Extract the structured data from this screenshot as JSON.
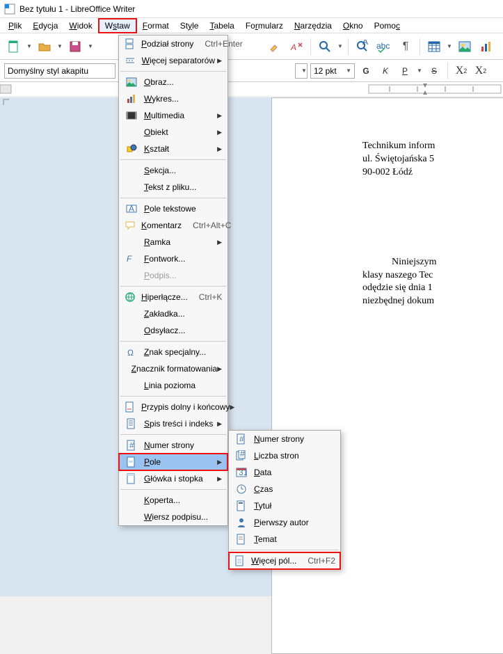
{
  "window": {
    "title": "Bez tytułu 1 - LibreOffice Writer"
  },
  "menubar": {
    "items": [
      "Plik",
      "Edycja",
      "Widok",
      "Wstaw",
      "Format",
      "Style",
      "Tabela",
      "Formularz",
      "Narzędzia",
      "Okno",
      "Pomoc"
    ],
    "open_index": 3
  },
  "fmtbar": {
    "style": "Domyślny styl akapitu",
    "fontsize": "12 pkt",
    "bold": "G",
    "italic": "K",
    "underline": "P",
    "strike": "S",
    "sup": "X²",
    "sub": "X₂"
  },
  "document": {
    "lines": [
      "Technikum inform",
      "ul. Świętojańska 5",
      "90-002 Łódź",
      "",
      "",
      "            Niniejszym",
      "klasy naszego Tec",
      "odędzie się dnia 1",
      "niezbędnej dokum"
    ]
  },
  "insert_menu": [
    {
      "type": "item",
      "icon": "page-break",
      "label": "Podział strony",
      "shortcut": "Ctrl+Enter"
    },
    {
      "type": "item",
      "icon": "separators",
      "label": "Więcej separatorów",
      "submenu": true
    },
    {
      "type": "sep"
    },
    {
      "type": "item",
      "icon": "image",
      "label": "Obraz..."
    },
    {
      "type": "item",
      "icon": "chart",
      "label": "Wykres..."
    },
    {
      "type": "item",
      "icon": "media",
      "label": "Multimedia",
      "submenu": true
    },
    {
      "type": "item",
      "icon": "object",
      "label": "Obiekt",
      "submenu": true
    },
    {
      "type": "item",
      "icon": "shape",
      "label": "Kształt",
      "submenu": true
    },
    {
      "type": "sep"
    },
    {
      "type": "item",
      "label": "Sekcja..."
    },
    {
      "type": "item",
      "label": "Tekst z pliku..."
    },
    {
      "type": "sep"
    },
    {
      "type": "item",
      "icon": "textbox",
      "label": "Pole tekstowe"
    },
    {
      "type": "item",
      "icon": "comment",
      "label": "Komentarz",
      "shortcut": "Ctrl+Alt+C"
    },
    {
      "type": "item",
      "label": "Ramka",
      "submenu": true
    },
    {
      "type": "item",
      "icon": "fontwork",
      "label": "Fontwork..."
    },
    {
      "type": "item",
      "label": "Podpis...",
      "disabled": true
    },
    {
      "type": "sep"
    },
    {
      "type": "item",
      "icon": "hyperlink",
      "label": "Hiperłącze...",
      "shortcut": "Ctrl+K"
    },
    {
      "type": "item",
      "label": "Zakładka..."
    },
    {
      "type": "item",
      "label": "Odsyłacz..."
    },
    {
      "type": "sep"
    },
    {
      "type": "item",
      "icon": "special",
      "label": "Znak specjalny..."
    },
    {
      "type": "item",
      "label": "Znacznik formatowania",
      "submenu": true
    },
    {
      "type": "item",
      "label": "Linia pozioma"
    },
    {
      "type": "sep"
    },
    {
      "type": "item",
      "icon": "footnote",
      "label": "Przypis dolny i końcowy",
      "submenu": true
    },
    {
      "type": "item",
      "icon": "toc",
      "label": "Spis treści i indeks",
      "submenu": true
    },
    {
      "type": "sep"
    },
    {
      "type": "item",
      "icon": "pagenum",
      "label": "Numer strony"
    },
    {
      "type": "item",
      "icon": "field",
      "label": "Pole",
      "submenu": true,
      "highlight": true,
      "boxed": true
    },
    {
      "type": "item",
      "icon": "header",
      "label": "Główka i stopka",
      "submenu": true
    },
    {
      "type": "sep"
    },
    {
      "type": "item",
      "label": "Koperta..."
    },
    {
      "type": "item",
      "label": "Wiersz podpisu..."
    }
  ],
  "field_submenu": [
    {
      "type": "item",
      "icon": "pagenum",
      "label": "Numer strony"
    },
    {
      "type": "item",
      "icon": "pagecount",
      "label": "Liczba stron"
    },
    {
      "type": "item",
      "icon": "date",
      "label": "Data"
    },
    {
      "type": "item",
      "icon": "time",
      "label": "Czas"
    },
    {
      "type": "item",
      "icon": "title",
      "label": "Tytuł"
    },
    {
      "type": "item",
      "icon": "author",
      "label": "Pierwszy autor"
    },
    {
      "type": "item",
      "icon": "subject",
      "label": "Temat"
    },
    {
      "type": "sep"
    },
    {
      "type": "item",
      "icon": "more",
      "label": "Więcej pól...",
      "shortcut": "Ctrl+F2",
      "boxed": true
    }
  ]
}
